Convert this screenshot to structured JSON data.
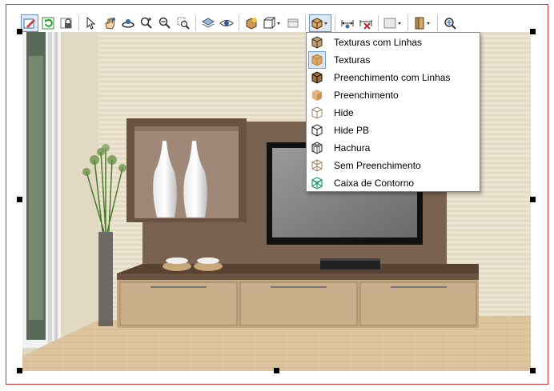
{
  "toolbar": {
    "buttons": [
      {
        "icon": "edit-pencil-icon"
      },
      {
        "icon": "refresh-icon"
      },
      {
        "icon": "lock-icon"
      },
      {
        "icon": "pointer-icon"
      },
      {
        "icon": "pan-hand-icon"
      },
      {
        "icon": "orbit-icon"
      },
      {
        "icon": "zoom-in-icon"
      },
      {
        "icon": "zoom-out-icon"
      },
      {
        "icon": "zoom-window-icon"
      },
      {
        "icon": "layers-icon"
      },
      {
        "icon": "eye-icon"
      },
      {
        "icon": "render-icon"
      },
      {
        "icon": "view-cube-icon"
      },
      {
        "icon": "section-icon"
      },
      {
        "icon": "display-mode-icon"
      },
      {
        "icon": "dimension-icon"
      },
      {
        "icon": "delete-dimension-icon"
      },
      {
        "icon": "color-icon"
      },
      {
        "icon": "door-icon"
      },
      {
        "icon": "search-zoom-icon"
      }
    ]
  },
  "render_mode_menu": {
    "selected_index": 1,
    "items": [
      {
        "label": "Texturas com Linhas",
        "icon": "cube-textured-lines-icon"
      },
      {
        "label": "Texturas",
        "icon": "cube-textured-icon"
      },
      {
        "label": "Preenchimento com Linhas",
        "icon": "cube-filled-lines-icon"
      },
      {
        "label": "Preenchimento",
        "icon": "cube-filled-icon"
      },
      {
        "label": "Hide",
        "icon": "cube-hide-icon"
      },
      {
        "label": "Hide PB",
        "icon": "cube-hide-bw-icon"
      },
      {
        "label": "Hachura",
        "icon": "cube-hatch-icon"
      },
      {
        "label": "Sem Preenchimento",
        "icon": "cube-wire-icon"
      },
      {
        "label": "Caixa de Contorno",
        "icon": "cube-bounding-box-icon"
      }
    ]
  },
  "colors": {
    "frame_border": "#d03030",
    "menu_highlight": "#dbe7f5",
    "wood_panel": "#7a6250",
    "wall": "#e8e0cc",
    "floor": "#dcc59e"
  }
}
